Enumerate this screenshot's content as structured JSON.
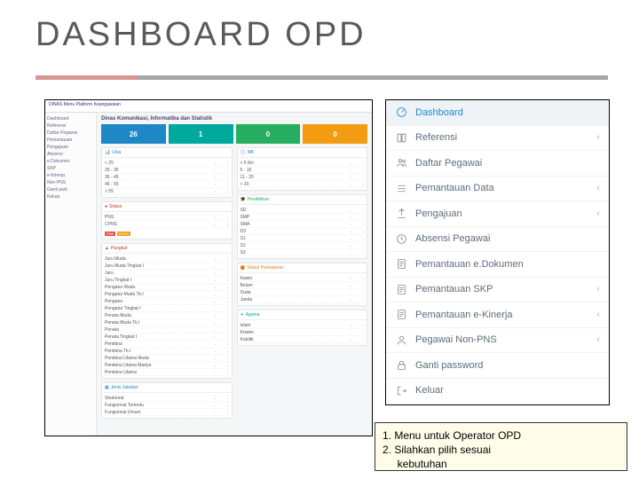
{
  "title": "DASHBOARD OPD",
  "screenshot": {
    "header": "DINAS Menu Platform Kepegawaian",
    "org": "Dinas Komunikasi, Informatika dan Statistik",
    "sidebar": [
      "Dashboard",
      "Referensi",
      "Daftar Pegawai",
      "Pemantauan",
      "Pengajuan",
      "Absensi",
      "e.Dokumen",
      "SKP",
      "e-Kinerja",
      "Non-PNS",
      "Ganti pwd",
      "Keluar"
    ],
    "stats": [
      {
        "v": "26"
      },
      {
        "v": "1"
      },
      {
        "v": "0"
      },
      {
        "v": "0"
      }
    ],
    "panels": {
      "usia": {
        "title": "Usia",
        "rows": [
          [
            "< 25",
            ".",
            "."
          ],
          [
            "25 - 35",
            ".",
            "."
          ],
          [
            "36 - 45",
            ".",
            "."
          ],
          [
            "46 - 55",
            ".",
            "."
          ],
          [
            "> 55",
            ".",
            "."
          ]
        ]
      },
      "mk": {
        "title": "MK",
        "rows": [
          [
            "< 5 thn",
            ".",
            "."
          ],
          [
            "5 - 10",
            ".",
            "."
          ],
          [
            "11 - 20",
            ".",
            "."
          ],
          [
            "> 20",
            ".",
            "."
          ]
        ]
      },
      "status": {
        "title": "Status",
        "rows": [
          [
            "PNS",
            ".",
            "."
          ],
          [
            "CPNS",
            ".",
            "."
          ]
        ]
      },
      "pendidikan": {
        "title": "Pendidikan",
        "rows": [
          [
            "SD",
            ".",
            "."
          ],
          [
            "SMP",
            ".",
            "."
          ],
          [
            "SMA",
            ".",
            "."
          ],
          [
            "D3",
            ".",
            "."
          ],
          [
            "S1",
            ".",
            "."
          ],
          [
            "S2",
            ".",
            "."
          ],
          [
            "S3",
            ".",
            "."
          ]
        ]
      },
      "pangkat": {
        "title": "Pangkat",
        "rows": [
          [
            "Juru Muda",
            ".",
            "."
          ],
          [
            "Juru Muda Tingkat I",
            ".",
            "."
          ],
          [
            "Juru",
            ".",
            "."
          ],
          [
            "Juru Tingkat I",
            ".",
            "."
          ],
          [
            "Pengatur Muda",
            ".",
            "."
          ],
          [
            "Pengatur Muda Tk.I",
            ".",
            "."
          ],
          [
            "Pengatur",
            ".",
            "."
          ],
          [
            "Pengatur Tingkat I",
            ".",
            "."
          ],
          [
            "Penata Muda",
            ".",
            "."
          ],
          [
            "Penata Muda Tk.I",
            ".",
            "."
          ],
          [
            "Penata",
            ".",
            "."
          ],
          [
            "Penata Tingkat I",
            ".",
            "."
          ],
          [
            "Pembina",
            ".",
            "."
          ],
          [
            "Pembina Tk.I",
            ".",
            "."
          ],
          [
            "Pembina Utama Muda",
            ".",
            "."
          ],
          [
            "Pembina Utama Madya",
            ".",
            "."
          ],
          [
            "Pembina Utama",
            ".",
            "."
          ]
        ]
      },
      "statperkawinan": {
        "title": "Status Perkawinan",
        "rows": [
          [
            "Kawin",
            ".",
            "."
          ],
          [
            "Belum",
            ".",
            "."
          ],
          [
            "Duda",
            ".",
            "."
          ],
          [
            "Janda",
            ".",
            "."
          ]
        ]
      },
      "agama": {
        "title": "Agama",
        "rows": [
          [
            "Islam",
            ".",
            "."
          ],
          [
            "Kristen",
            ".",
            "."
          ],
          [
            "Katolik",
            ".",
            "."
          ]
        ]
      },
      "jabatan": {
        "title": "Jenis Jabatan",
        "rows": [
          [
            "Struktural",
            ".",
            "."
          ],
          [
            "Fungsional Tertentu",
            ".",
            "."
          ],
          [
            "Fungsional Umum",
            ".",
            "."
          ]
        ]
      }
    }
  },
  "menu": [
    {
      "icon": "dashboard",
      "label": "Dashboard",
      "chev": false,
      "active": true
    },
    {
      "icon": "book",
      "label": "Referensi",
      "chev": true
    },
    {
      "icon": "users",
      "label": "Daftar Pegawai",
      "chev": false
    },
    {
      "icon": "list",
      "label": "Pemantauan Data",
      "chev": true
    },
    {
      "icon": "upload",
      "label": "Pengajuan",
      "chev": true
    },
    {
      "icon": "clock",
      "label": "Absensi Pegawai",
      "chev": false
    },
    {
      "icon": "doc",
      "label": "Pemantauan e.Dokumen",
      "chev": false
    },
    {
      "icon": "doc",
      "label": "Pemantauan SKP",
      "chev": true
    },
    {
      "icon": "doc",
      "label": "Pemantauan e-Kinerja",
      "chev": true
    },
    {
      "icon": "user",
      "label": "Pegawai Non-PNS",
      "chev": true
    },
    {
      "icon": "lock",
      "label": "Ganti password",
      "chev": false
    },
    {
      "icon": "logout",
      "label": "Keluar",
      "chev": false
    }
  ],
  "note": {
    "i1": "1.  Menu untuk Operator OPD",
    "i2": "2.  Silahkan pilih sesuai",
    "i3": "     kebutuhan"
  }
}
